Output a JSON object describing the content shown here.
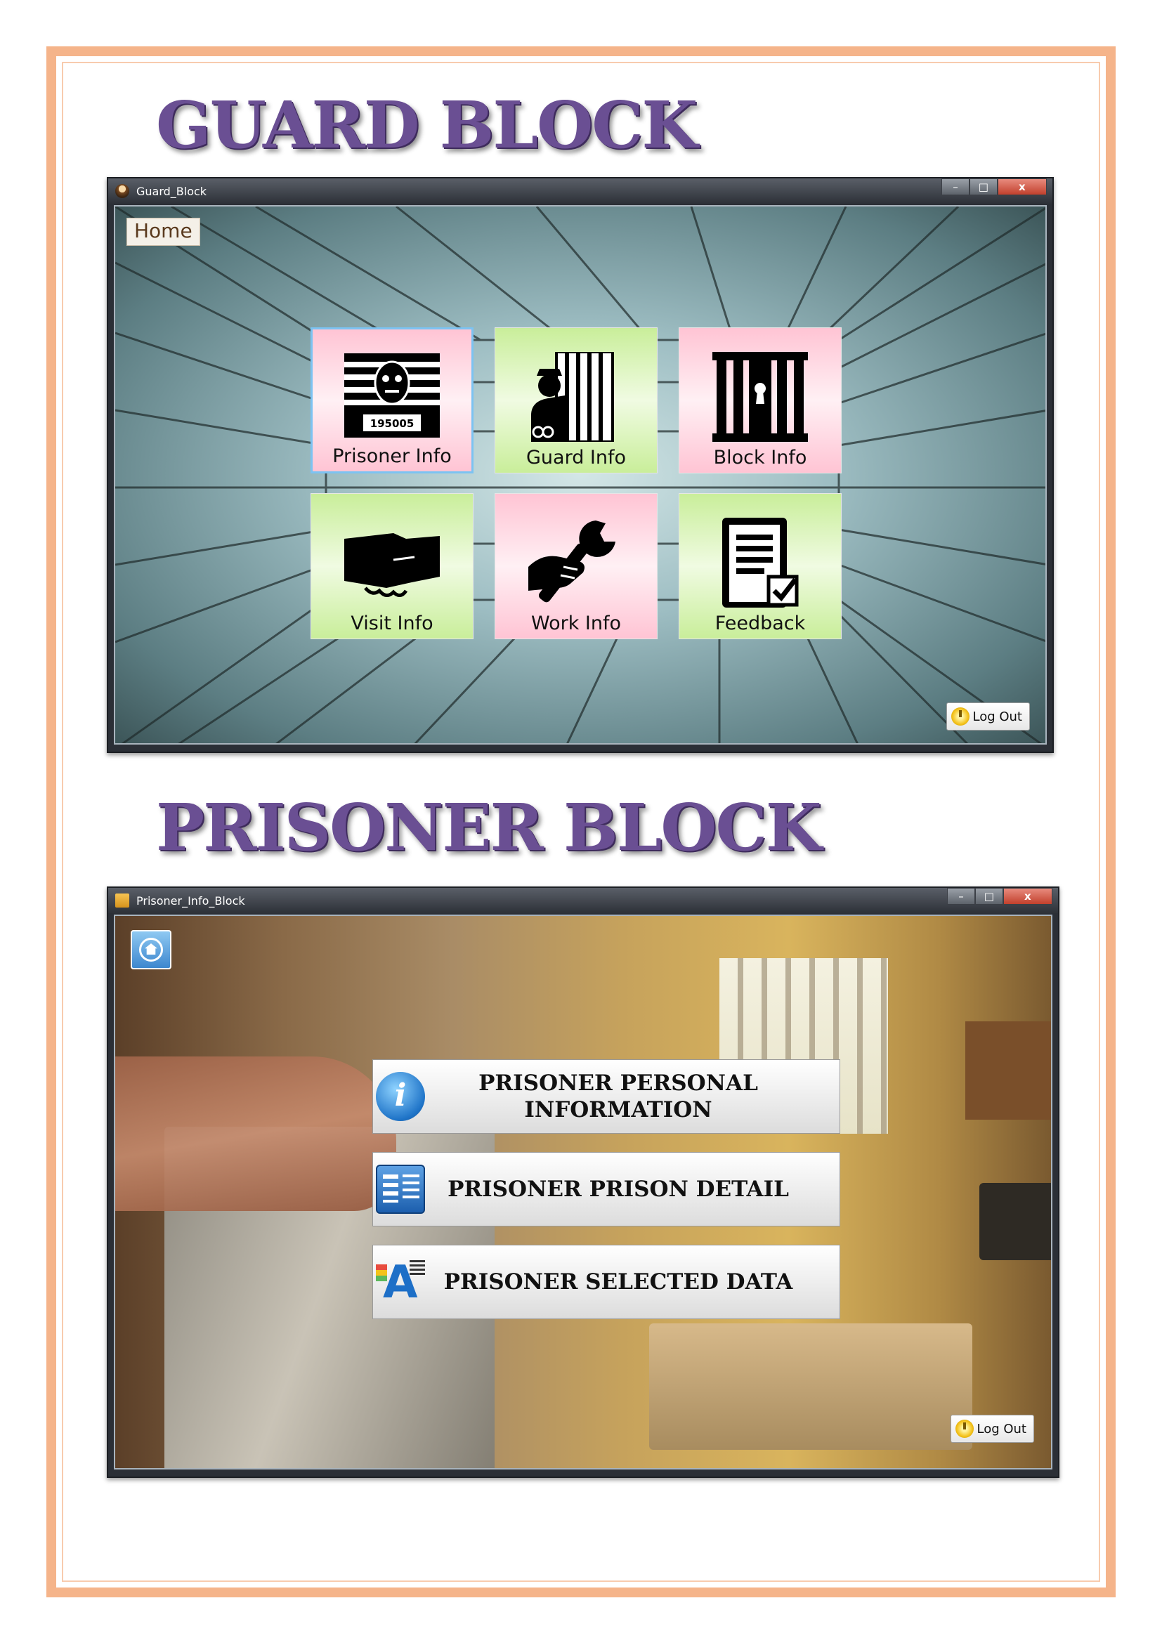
{
  "headings": {
    "guard_block": "GUARD BLOCK",
    "prisoner_block": "PRISONER BLOCK"
  },
  "guard_window": {
    "title": "Guard_Block",
    "controls": {
      "minimize": "–",
      "maximize": "□",
      "close": "x"
    },
    "home_tab": "Home",
    "tiles": [
      {
        "label": "Prisoner Info",
        "icon": "prisoner-mugshot-icon",
        "color": "pink",
        "selected": true,
        "badge_number": "195005"
      },
      {
        "label": "Guard Info",
        "icon": "guard-bars-icon",
        "color": "green"
      },
      {
        "label": "Block Info",
        "icon": "cell-block-icon",
        "color": "pink"
      },
      {
        "label": "Visit Info",
        "icon": "handshake-icon",
        "color": "green"
      },
      {
        "label": "Work Info",
        "icon": "wrench-hand-icon",
        "color": "pink"
      },
      {
        "label": "Feedback",
        "icon": "checklist-icon",
        "color": "green"
      }
    ],
    "logout_label": "Log Out"
  },
  "prisoner_window": {
    "title": "Prisoner_Info_Block",
    "controls": {
      "minimize": "–",
      "maximize": "□",
      "close": "x"
    },
    "buttons": [
      {
        "label": "PRISONER PERSONAL INFORMATION",
        "icon": "info-icon"
      },
      {
        "label": "PRISONER PRISON DETAIL",
        "icon": "detail-card-icon"
      },
      {
        "label": "PRISONER SELECTED DATA",
        "icon": "selected-data-icon",
        "glyph": "A"
      }
    ],
    "logout_label": "Log Out"
  },
  "colors": {
    "page_border": "#f5b48a",
    "heading": "#6a4f93",
    "tile_pink": "#ffc4d4",
    "tile_green": "#c9ee9a",
    "tile_selected_border": "#7cc3f2"
  }
}
